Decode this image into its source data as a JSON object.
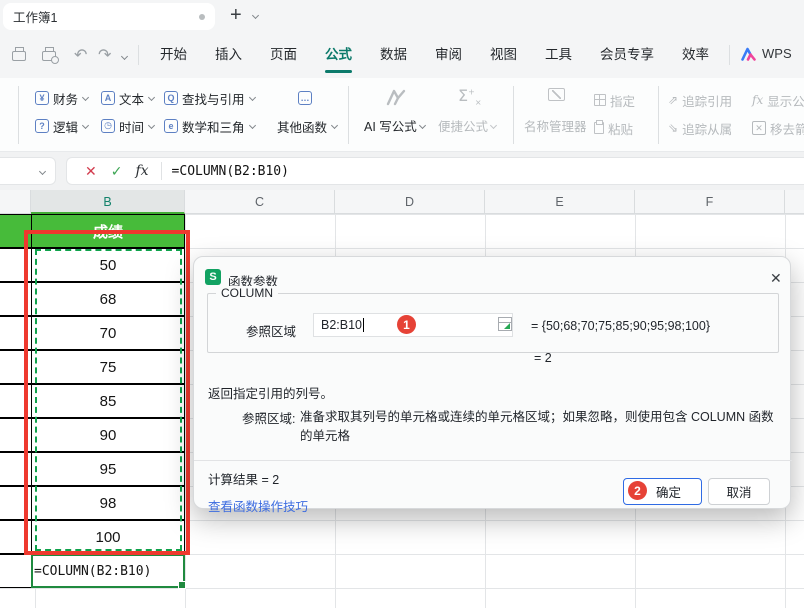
{
  "window": {
    "tab_title": "工作簿1",
    "new_tab": "+"
  },
  "ribbon": {
    "tabs": [
      "开始",
      "插入",
      "页面",
      "公式",
      "数据",
      "审阅",
      "视图",
      "工具",
      "会员专享",
      "效率"
    ],
    "active_tab": "公式",
    "brand": "WPS",
    "fin": "财务",
    "text": "文本",
    "lookup": "查找与引用",
    "more_dots": "…",
    "logic": "逻辑",
    "time": "时间",
    "math": "数学和三角",
    "other_fn": "其他函数",
    "ai_formula": "AI 写公式",
    "quick_formula": "便捷公式",
    "name_manager": "名称管理器",
    "assign": "指定",
    "paste": "粘贴",
    "trace_precedents": "追踪引用",
    "trace_dependents": "追踪从属",
    "show_formulas": "显示公式",
    "remove_arrows": "移去箭头",
    "icon_fin": "¥",
    "icon_text": "A",
    "icon_lookup": "Q",
    "icon_logic": "?",
    "icon_time": "◷",
    "icon_math": "e",
    "icon_sigma": "Σ",
    "icon_fx": "fx",
    "icon_remove": "✕",
    "icon_trace_up": "⇗",
    "icon_trace_down": "⇘"
  },
  "formula_bar": {
    "cancel": "✕",
    "enter": "✓",
    "fx": "fx",
    "formula": "=COLUMN(B2:B10)"
  },
  "sheet": {
    "columns": [
      "B",
      "C",
      "D",
      "E",
      "F"
    ],
    "selected_column": "B",
    "header_cell": "成绩",
    "values": [
      "50",
      "68",
      "70",
      "75",
      "85",
      "90",
      "95",
      "98",
      "100"
    ],
    "formula_cell": "=COLUMN(B2:B10)"
  },
  "dialog": {
    "app_icon": "S",
    "title": "函数参数",
    "close": "✕",
    "function_name": "COLUMN",
    "arg_label": "参照区域",
    "arg_value": "B2:B10",
    "array_result": "= {50;68;70;75;85;90;95;98;100}",
    "value_result": "= 2",
    "description": "返回指定引用的列号。",
    "param_label": "参照区域:",
    "param_desc": "准备求取其列号的单元格或连续的单元格区域；如果忽略，则使用包含 COLUMN 函数的单元格",
    "calc_result": "计算结果 = 2",
    "tips_link": "查看函数操作技巧",
    "ok": "确定",
    "cancel": "取消"
  },
  "annotations": {
    "step1": "1",
    "step2": "2"
  },
  "colors": {
    "cell_green": "#47bb3a",
    "annotation_red": "#ee392e",
    "active_tab_teal": "#0c7a6b",
    "ants_green": "#0ea24b",
    "ok_border_blue": "#2f6be4",
    "link_blue": "#3c6ce0",
    "badge_red": "#e64236",
    "dialog_icon_green": "#12a262"
  }
}
